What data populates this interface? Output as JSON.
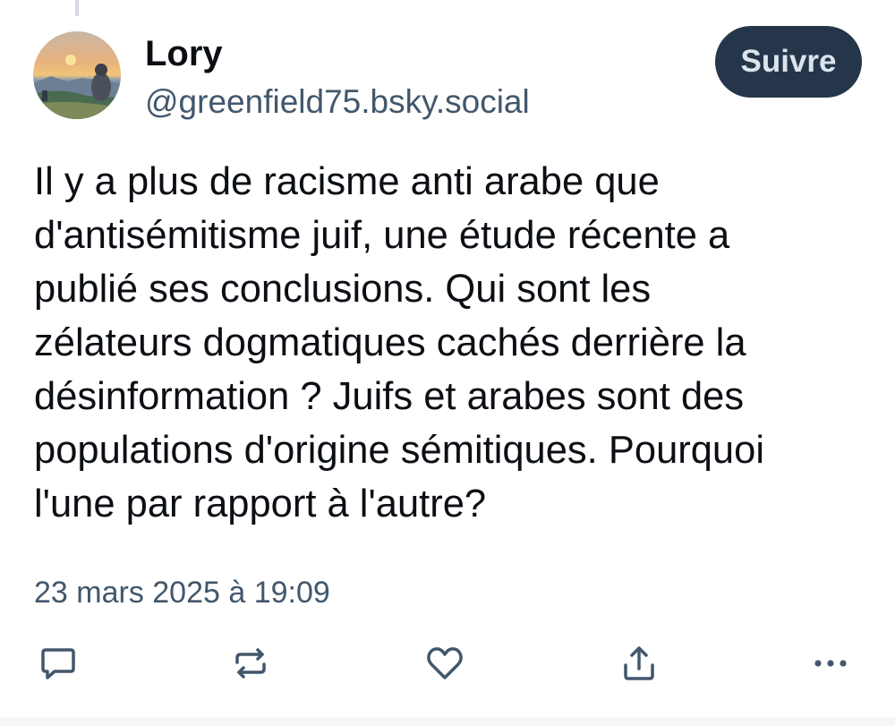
{
  "post": {
    "author": {
      "display_name": "Lory",
      "handle": "@greenfield75.bsky.social"
    },
    "follow_label": "Suivre",
    "text": "Il y a plus de racisme anti arabe que\nd'antisémitisme juif, une étude récente a\npublié ses conclusions. Qui sont les\nzélateurs dogmatiques cachés derrière la\ndésinformation ? Juifs et arabes sont des\npopulations d'origine sémitiques. Pourquoi\nl'une par rapport à l'autre?",
    "timestamp": "23 mars 2025 à 19:09"
  },
  "actions": [
    {
      "icon": "reply-icon"
    },
    {
      "icon": "repost-icon"
    },
    {
      "icon": "like-icon"
    },
    {
      "icon": "share-icon"
    },
    {
      "icon": "more-icon"
    }
  ],
  "colors": {
    "text_primary": "#0b0f14",
    "text_secondary": "#42576c",
    "follow_button_bg": "#25364a",
    "follow_button_text": "#dbe3ec",
    "icon": "#42576c"
  }
}
